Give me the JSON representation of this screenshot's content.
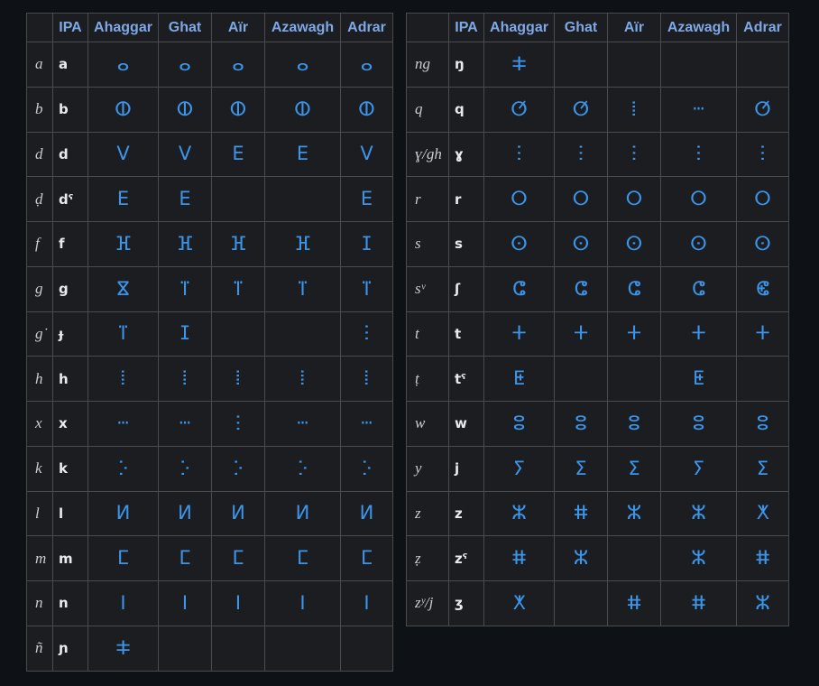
{
  "headers": [
    "",
    "IPA",
    "Ahaggar",
    "Ghat",
    "Aïr",
    "Azawagh",
    "Adrar"
  ],
  "left_rows": [
    {
      "latin": "a",
      "ipa": "a",
      "ahaggar": "ⴰ",
      "ghat": "ⴰ",
      "air": "ⴰ",
      "azawagh": "ⴰ",
      "adrar": "ⴰ"
    },
    {
      "latin": "b",
      "ipa": "b",
      "ahaggar": "ⵀ",
      "ghat": "ⵀ",
      "air": "ⵀ",
      "azawagh": "ⵀ",
      "adrar": "ⵀ"
    },
    {
      "latin": "d",
      "ipa": "d",
      "ahaggar": "ⴸ",
      "ghat": "ⴸ",
      "air": "ⴹ",
      "azawagh": "ⴹ",
      "adrar": "ⴸ"
    },
    {
      "latin": "ḍ",
      "ipa": "dˤ",
      "ahaggar": "ⴹ",
      "ghat": "ⴹ",
      "air": "",
      "azawagh": "",
      "adrar": "ⴹ"
    },
    {
      "latin": "f",
      "ipa": "f",
      "ahaggar": "ⴼ",
      "ghat": "ⴼ",
      "air": "ⴼ",
      "azawagh": "ⴼ",
      "adrar": "ⵊ"
    },
    {
      "latin": "g",
      "ipa": "g",
      "ahaggar": "ⴵ",
      "ghat": "ⴶ",
      "air": "ⴶ",
      "azawagh": "ⴶ",
      "adrar": "ⴶ"
    },
    {
      "latin": "g˙",
      "ipa": "ɟ",
      "ahaggar": "ⴶ",
      "ghat": "ⵊ",
      "air": "",
      "azawagh": "",
      "adrar": "ⵗ"
    },
    {
      "latin": "h",
      "ipa": "h",
      "ahaggar": "ⵂ",
      "ghat": "ⵂ",
      "air": "ⵂ",
      "azawagh": "ⵂ",
      "adrar": "ⵂ"
    },
    {
      "latin": "x",
      "ipa": "x",
      "ahaggar": "ⵈ",
      "ghat": "ⵈ",
      "air": "ⵗ",
      "azawagh": "ⵈ",
      "adrar": "ⵈ"
    },
    {
      "latin": "k",
      "ipa": "k",
      "ahaggar": "ⴾ",
      "ghat": "ⴾ",
      "air": "ⴾ",
      "azawagh": "ⴾ",
      "adrar": "ⴾ"
    },
    {
      "latin": "l",
      "ipa": "l",
      "ahaggar": "ⵍ",
      "ghat": "ⵍ",
      "air": "ⵍ",
      "azawagh": "ⵍ",
      "adrar": "ⵍ"
    },
    {
      "latin": "m",
      "ipa": "m",
      "ahaggar": "ⵎ",
      "ghat": "ⵎ",
      "air": "ⵎ",
      "azawagh": "ⵎ",
      "adrar": "ⵎ"
    },
    {
      "latin": "n",
      "ipa": "n",
      "ahaggar": "ⵏ",
      "ghat": "ⵏ",
      "air": "ⵏ",
      "azawagh": "ⵏ",
      "adrar": "ⵏ"
    },
    {
      "latin": "ñ",
      "ipa": "ɲ",
      "ahaggar": "ⵐ",
      "ghat": "",
      "air": "",
      "azawagh": "",
      "adrar": ""
    }
  ],
  "right_rows": [
    {
      "latin": "ng",
      "ipa": "ŋ",
      "ahaggar": "ⵐ",
      "ghat": "",
      "air": "",
      "azawagh": "",
      "adrar": ""
    },
    {
      "latin": "q",
      "ipa": "q",
      "ahaggar": "ⵚ",
      "ghat": "ⵚ",
      "air": "ⵂ",
      "azawagh": "ⵈ",
      "adrar": "ⵚ"
    },
    {
      "latin": "ɣ/gh",
      "ipa": "ɣ",
      "ahaggar": "ⵗ",
      "ghat": "ⵗ",
      "air": "ⵗ",
      "azawagh": "ⵗ",
      "adrar": "ⵗ"
    },
    {
      "latin": "r",
      "ipa": "r",
      "ahaggar": "ⵔ",
      "ghat": "ⵔ",
      "air": "ⵔ",
      "azawagh": "ⵔ",
      "adrar": "ⵔ"
    },
    {
      "latin": "s",
      "ipa": "s",
      "ahaggar": "ⵙ",
      "ghat": "ⵙ",
      "air": "ⵙ",
      "azawagh": "ⵙ",
      "adrar": "ⵙ"
    },
    {
      "latin": "sᵛ",
      "ipa": "ʃ",
      "ahaggar": "ⵛ",
      "ghat": "ⵛ",
      "air": "ⵛ",
      "azawagh": "ⵛ",
      "adrar": "ⵞ"
    },
    {
      "latin": "t",
      "ipa": "t",
      "ahaggar": "ⵜ",
      "ghat": "ⵜ",
      "air": "ⵜ",
      "azawagh": "ⵜ",
      "adrar": "ⵜ"
    },
    {
      "latin": "ṭ",
      "ipa": "tˤ",
      "ahaggar": "ⵟ",
      "ghat": "",
      "air": "",
      "azawagh": "ⵟ",
      "adrar": ""
    },
    {
      "latin": "w",
      "ipa": "w",
      "ahaggar": "ⵓ",
      "ghat": "ⵓ",
      "air": "ⵓ",
      "azawagh": "ⵓ",
      "adrar": "ⵓ"
    },
    {
      "latin": "y",
      "ipa": "j",
      "ahaggar": "ⵢ",
      "ghat": "ⵉ",
      "air": "ⵉ",
      "azawagh": "ⵢ",
      "adrar": "ⵉ"
    },
    {
      "latin": "z",
      "ipa": "z",
      "ahaggar": "ⵣ",
      "ghat": "ⵌ",
      "air": "ⵣ",
      "azawagh": "ⵣ",
      "adrar": "ⵅ"
    },
    {
      "latin": "ẓ",
      "ipa": "zˤ",
      "ahaggar": "ⵌ",
      "ghat": "ⵣ",
      "air": "",
      "azawagh": "ⵣ",
      "adrar": "ⵌ"
    },
    {
      "latin": "zʸ/j",
      "ipa": "ʒ",
      "ahaggar": "ⵅ",
      "ghat": "",
      "air": "ⵌ",
      "azawagh": "ⵌ",
      "adrar": "ⵣ"
    }
  ]
}
